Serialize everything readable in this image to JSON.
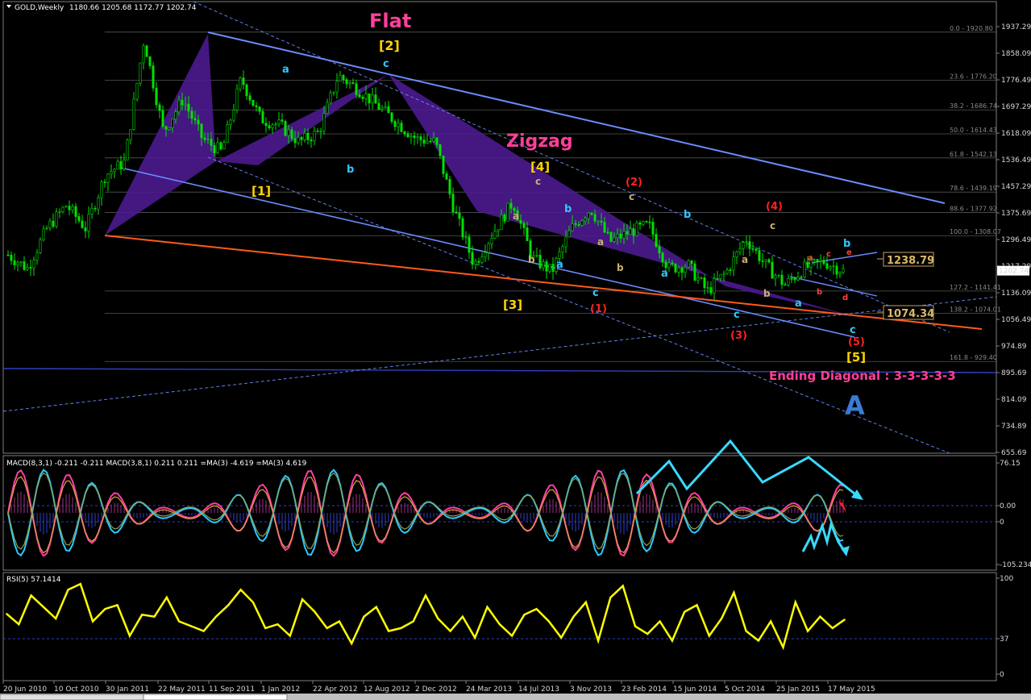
{
  "header": {
    "symbol": "GOLD,Weekly",
    "ohlc": "1180.66 1205.68 1172.77 1202.74"
  },
  "annotations": {
    "flat": "Flat",
    "zigzag": "Zigzag",
    "ending_diagonal": "Ending Diagonal : 3-3-3-3-3",
    "big_a": "A",
    "price_box_upper": "1238.79",
    "price_box_lower": "1074.34",
    "last_price": "1202.74",
    "wave_labels": [
      {
        "t": "[2]",
        "c": "#ffd400"
      },
      {
        "t": "[1]",
        "c": "#ffd400"
      },
      {
        "t": "[3]",
        "c": "#ffd400"
      },
      {
        "t": "[4]",
        "c": "#ffd400"
      },
      {
        "t": "[5]",
        "c": "#ffd400"
      },
      {
        "t": "a",
        "c": "#2ec8ff"
      },
      {
        "t": "b",
        "c": "#2ec8ff"
      },
      {
        "t": "c",
        "c": "#2ec8ff"
      },
      {
        "t": "a",
        "c": "#2ec8ff"
      },
      {
        "t": "b",
        "c": "#2ec8ff"
      },
      {
        "t": "c",
        "c": "#2ec8ff"
      },
      {
        "t": "a",
        "c": "#2ec8ff"
      },
      {
        "t": "b",
        "c": "#2ec8ff"
      },
      {
        "t": "c",
        "c": "#2ec8ff"
      },
      {
        "t": "a",
        "c": "#2ec8ff"
      },
      {
        "t": "b",
        "c": "#2ec8ff"
      },
      {
        "t": "c",
        "c": "#2ec8ff"
      },
      {
        "t": "(1)",
        "c": "#ff2020"
      },
      {
        "t": "(2)",
        "c": "#ff2020"
      },
      {
        "t": "(3)",
        "c": "#ff2020"
      },
      {
        "t": "(4)",
        "c": "#ff2020"
      },
      {
        "t": "(5)",
        "c": "#ff2020"
      },
      {
        "t": "a",
        "c": "#c8b070"
      },
      {
        "t": "b",
        "c": "#c8b070"
      },
      {
        "t": "c",
        "c": "#c8b070"
      },
      {
        "t": "a",
        "c": "#c8b070"
      },
      {
        "t": "b",
        "c": "#c8b070"
      },
      {
        "t": "c",
        "c": "#c8b070"
      },
      {
        "t": "a",
        "c": "#c8b070"
      },
      {
        "t": "b",
        "c": "#c8b070"
      },
      {
        "t": "c",
        "c": "#c8b070"
      },
      {
        "t": "a",
        "c": "#ff4040"
      },
      {
        "t": "b",
        "c": "#ff4040"
      },
      {
        "t": "c",
        "c": "#ff4040"
      },
      {
        "t": "d",
        "c": "#ff4040"
      },
      {
        "t": "e",
        "c": "#ff4040"
      }
    ]
  },
  "chart_data": [
    {
      "type": "candlestick",
      "ylim": [
        655.69,
        1937.29
      ],
      "yticks": [
        "1937.29",
        "1858.09",
        "1776.49",
        "1697.29",
        "1618.09",
        "1536.49",
        "1457.29",
        "1375.69",
        "1296.49",
        "1217.29",
        "1136.09",
        "1056.49",
        "974.89",
        "895.69",
        "814.09",
        "734.89",
        "655.69"
      ],
      "fib_levels": [
        {
          "label": "0.0 - 1920.80",
          "v": 1920.8
        },
        {
          "label": "23.6 - 1776.20",
          "v": 1776.2
        },
        {
          "label": "38.2 - 1686.74",
          "v": 1686.74
        },
        {
          "label": "50.0 - 1614.43",
          "v": 1614.43
        },
        {
          "label": "61.8 - 1542.13",
          "v": 1542.13
        },
        {
          "label": "78.6 - 1439.19",
          "v": 1439.19
        },
        {
          "label": "88.6 - 1377.92",
          "v": 1377.92
        },
        {
          "label": "100.0 - 1308.07",
          "v": 1308.07
        },
        {
          "label": "127.2 - 1141.41",
          "v": 1141.41
        },
        {
          "label": "138.2 - 1074.01",
          "v": 1074.01
        },
        {
          "label": "161.8 - 929.40",
          "v": 929.4
        }
      ],
      "close_path": [
        [
          "20 Jun 2010",
          1250
        ],
        [
          "Aug 2010",
          1210
        ],
        [
          "10 Oct 2010",
          1330
        ],
        [
          "Dec 2010",
          1400
        ],
        [
          "30 Jan 2011",
          1330
        ],
        [
          "Apr 2011",
          1490
        ],
        [
          "22 May 2011",
          1530
        ],
        [
          "Aug 2011",
          1900
        ],
        [
          "11 Sep 2011",
          1620
        ],
        [
          "Oct 2011",
          1720
        ],
        [
          "Dec 2011",
          1600
        ],
        [
          "1 Jan 2012",
          1560
        ],
        [
          "Feb 2012",
          1780
        ],
        [
          "Mar 2012",
          1660
        ],
        [
          "22 Apr 2012",
          1640
        ],
        [
          "Jun 2012",
          1590
        ],
        [
          "12 Aug 2012",
          1620
        ],
        [
          "Sep 2012",
          1790
        ],
        [
          "Oct 2012",
          1750
        ],
        [
          "2 Dec 2012",
          1700
        ],
        [
          "Feb 2013",
          1650
        ],
        [
          "Mar 2013",
          1600
        ],
        [
          "24 Mar 2013",
          1590
        ],
        [
          "Apr 2013",
          1380
        ],
        [
          "Jun 2013",
          1220
        ],
        [
          "14 Jul 2013",
          1320
        ],
        [
          "Aug 2013",
          1410
        ],
        [
          "3 Nov 2013",
          1240
        ],
        [
          "Dec 2013",
          1200
        ],
        [
          "23 Feb 2014",
          1330
        ],
        [
          "Mar 2014",
          1390
        ],
        [
          "Apr 2014",
          1290
        ],
        [
          "15 Jun 2014",
          1320
        ],
        [
          "Jul 2014",
          1340
        ],
        [
          "Sep 2014",
          1210
        ],
        [
          "5 Oct 2014",
          1220
        ],
        [
          "Nov 2014",
          1140
        ],
        [
          "Dec 2014",
          1200
        ],
        [
          "25 Jan 2015",
          1300
        ],
        [
          "Feb 2015",
          1220
        ],
        [
          "Mar 2015",
          1160
        ],
        [
          "Apr 2015",
          1210
        ],
        [
          "17 May 2015",
          1230
        ],
        [
          "Jun 2015",
          1202.74
        ]
      ]
    },
    {
      "type": "line",
      "title": "MACD(8,3,1) -0.211 -0.211  MACD(3,8,1) 0.211 0.211  =MA(3) -4.619  =MA(3) 4.619",
      "yticks": [
        "76.15",
        "0.00",
        "0",
        "-105.234"
      ]
    },
    {
      "type": "line",
      "title": "RSI(5) 57.1414",
      "ylim": [
        0,
        100
      ],
      "yticks": [
        "100",
        "37",
        "0"
      ],
      "values": [
        63,
        52,
        82,
        70,
        58,
        88,
        94,
        55,
        68,
        72,
        40,
        62,
        60,
        80,
        55,
        50,
        45,
        60,
        72,
        88,
        75,
        48,
        52,
        40,
        78,
        65,
        48,
        55,
        32,
        60,
        70,
        45,
        48,
        55,
        82,
        58,
        45,
        60,
        38,
        70,
        52,
        40,
        62,
        68,
        55,
        38,
        60,
        75,
        35,
        80,
        92,
        50,
        42,
        55,
        35,
        65,
        72,
        40,
        58,
        85,
        45,
        35,
        55,
        28,
        75,
        45,
        60,
        48,
        57
      ]
    }
  ],
  "xaxis": {
    "labels": [
      "20 Jun 2010",
      "10 Oct 2010",
      "30 Jan 2011",
      "22 May 2011",
      "11 Sep 2011",
      "1 Jan 2012",
      "22 Apr 2012",
      "12 Aug 2012",
      "2 Dec 2012",
      "24 Mar 2013",
      "14 Jul 2013",
      "3 Nov 2013",
      "23 Feb 2014",
      "15 Jun 2014",
      "5 Oct 2014",
      "25 Jan 2015",
      "17 May 2015"
    ]
  }
}
